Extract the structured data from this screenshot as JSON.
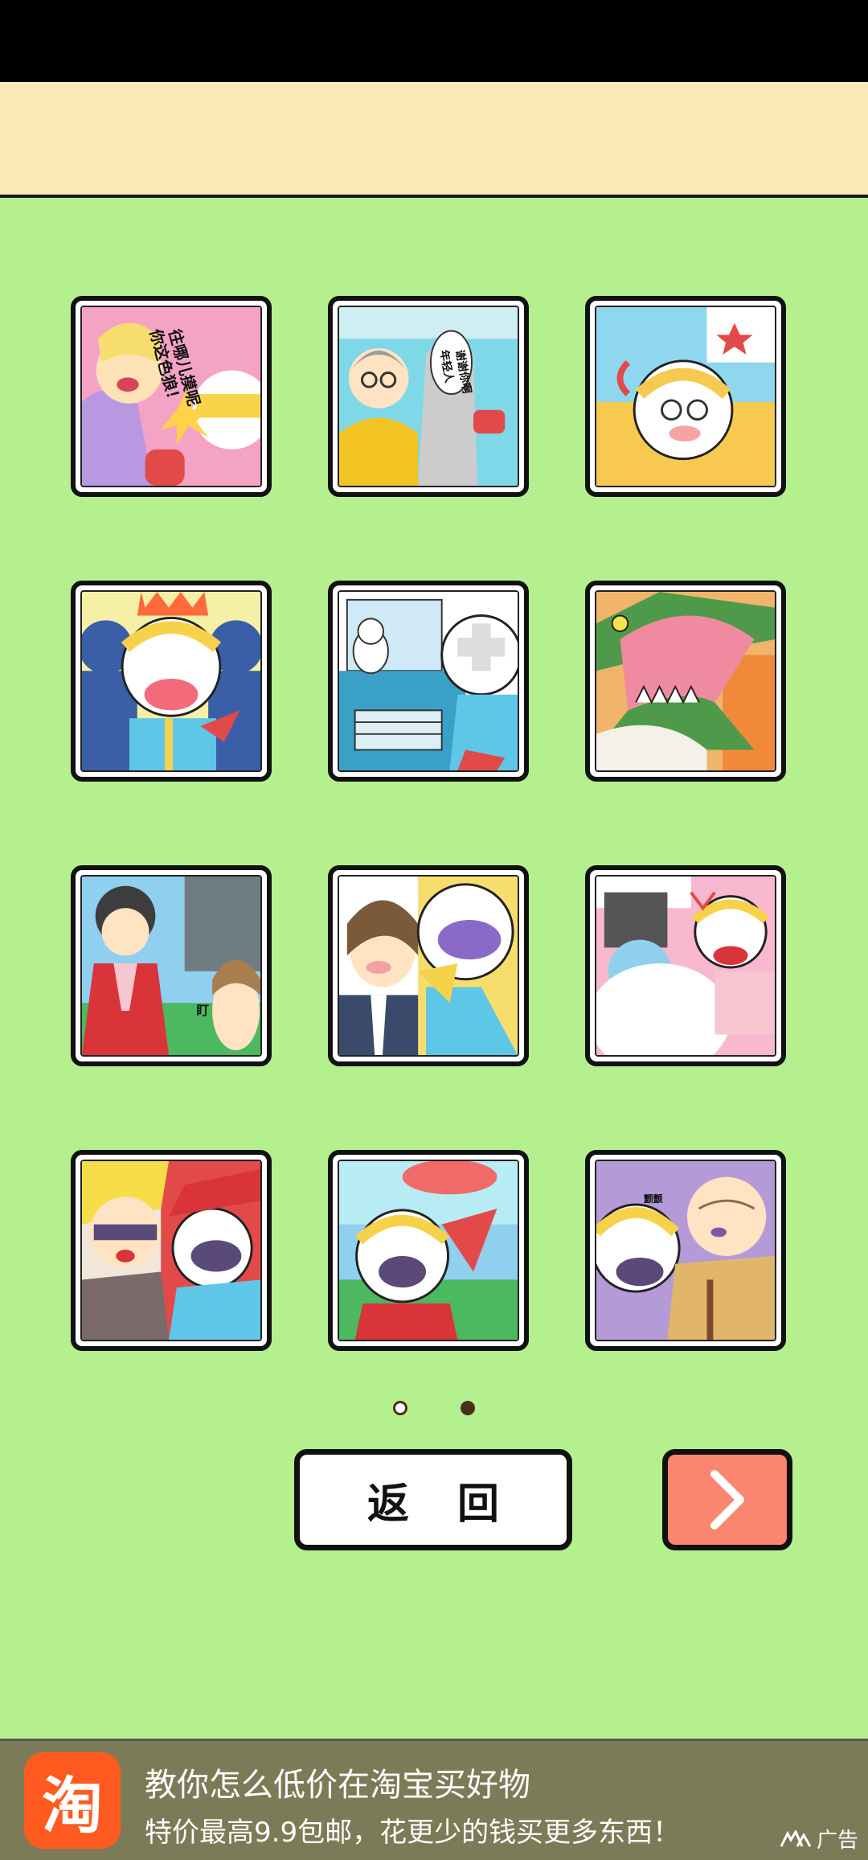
{
  "gallery": {
    "tiles": [
      {
        "id": "scene-1",
        "caption_lines": [
          "往哪儿摸呢",
          "你这色狼！"
        ]
      },
      {
        "id": "scene-2",
        "caption_lines": [
          "年轻人",
          "谢谢你啊"
        ]
      },
      {
        "id": "scene-3"
      },
      {
        "id": "scene-4"
      },
      {
        "id": "scene-5"
      },
      {
        "id": "scene-6"
      },
      {
        "id": "scene-7",
        "caption_lines": [
          "盯"
        ]
      },
      {
        "id": "scene-8"
      },
      {
        "id": "scene-9"
      },
      {
        "id": "scene-10"
      },
      {
        "id": "scene-11"
      },
      {
        "id": "scene-12",
        "caption_lines": [
          "颤颤"
        ]
      }
    ]
  },
  "pagination": {
    "current_page": 2,
    "total_pages": 2
  },
  "buttons": {
    "back_label": "返回",
    "next_icon": "chevron-right-icon"
  },
  "ad": {
    "app_icon": "taobao-logo",
    "logo_glyph": "淘",
    "title": "教你怎么低价在淘宝买好物",
    "subtitle": "特价最高9.9包邮，花更少的钱买更多东西！",
    "badge_label": "广告"
  },
  "colors": {
    "background": "#b5f08f",
    "top_banner": "#fce9b8",
    "next_button": "#fb8670",
    "ad_bar": "#7b7b58",
    "taobao_orange": "#ff5a1f"
  }
}
